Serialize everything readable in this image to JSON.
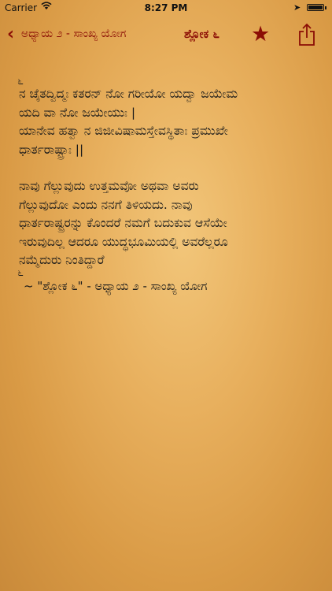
{
  "status_bar": {
    "carrier": "Carrier",
    "time": "8:27 PM"
  },
  "nav": {
    "back_label": "ಅಧ್ಯಾಯ ೨ - ಸಾಂಖ್ಯ ಯೋಗ",
    "title": "ಶ್ಲೋಕ ೬",
    "icons": {
      "back": "chevron-left-icon",
      "favorite": "star-icon",
      "share": "share-icon"
    },
    "accent_color": "#8b0d05"
  },
  "verse": {
    "marker_top": "೬",
    "sanskrit": "ನ ಚೈತದ್ವಿದ್ಮಃ ಕತರನ್ ನೋ ಗರೀಯೋ ಯದ್ವಾ ಜಯೇಮ\nಯದಿ ವಾ ನೋ ಜಯೇಯುಃ |\nಯಾನೇವ ಹತ್ವಾ ನ ಜಿಜೀವಿಷಾಮಸ್ತೇ‌ವಸ್ಥಿತಾಃ ಪ್ರಮುಖೇ\nಧಾರ್ತರಾಷ್ಟ್ರಾಃ ||",
    "translation": "ನಾವು ಗೆಲ್ಲುವುದು ಉತ್ತಮವೋ ಅಥವಾ ಅವರು\nಗೆಲ್ಲುವುದೋ ಎಂದು ನನಗೆ ತಿಳಿಯದು. ನಾವು\nಧಾರ್ತರಾಷ್ಟ್ರರನ್ನು ಕೊಂದರೆ ನಮಗೆ ಬದುಕುವ ಆಸೆಯೇ\nಇರುವುದಿಲ್ಲ ಆದರೂ ಯುದ್ಧಭೂಮಿಯಲ್ಲಿ ಅವರೆಲ್ಲರೂ\nನಮ್ಮೆದುರು ನಿಂತಿದ್ದಾರೆ",
    "marker_bottom": "೬",
    "citation": "~ \"ಶ್ಲೋಕ ೬\" - ಅಧ್ಯಾಯ ೨ - ಸಾಂಖ್ಯ ಯೋಗ"
  }
}
